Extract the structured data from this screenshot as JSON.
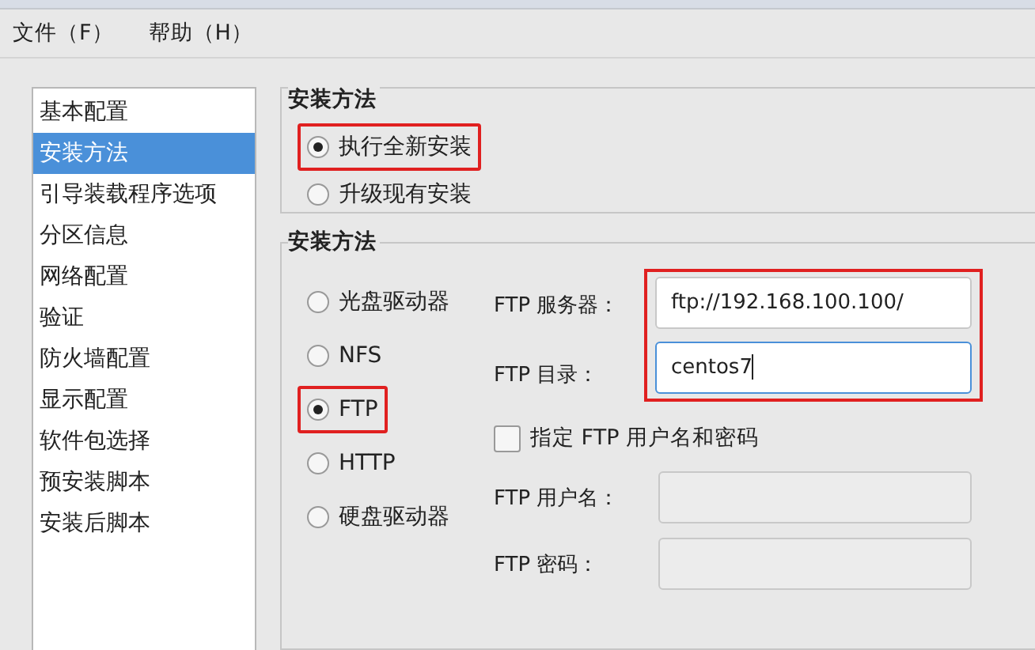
{
  "menu": [
    "文件（F）",
    "帮助（H）"
  ],
  "sidebar": {
    "items": [
      {
        "label": "基本配置",
        "selected": false
      },
      {
        "label": "安装方法",
        "selected": true
      },
      {
        "label": "引导装载程序选项",
        "selected": false
      },
      {
        "label": "分区信息",
        "selected": false
      },
      {
        "label": "网络配置",
        "selected": false
      },
      {
        "label": "验证",
        "selected": false
      },
      {
        "label": "防火墙配置",
        "selected": false
      },
      {
        "label": "显示配置",
        "selected": false
      },
      {
        "label": "软件包选择",
        "selected": false
      },
      {
        "label": "预安装脚本",
        "selected": false
      },
      {
        "label": "安装后脚本",
        "selected": false
      }
    ]
  },
  "install_type": {
    "title": "安装方法",
    "options": [
      {
        "label": "执行全新安装",
        "selected": true,
        "highlighted": true
      },
      {
        "label": "升级现有安装",
        "selected": false,
        "highlighted": false
      }
    ]
  },
  "install_source": {
    "title": "安装方法",
    "options": [
      {
        "label": "光盘驱动器",
        "selected": false,
        "highlighted": false
      },
      {
        "label": "NFS",
        "selected": false,
        "highlighted": false
      },
      {
        "label": "FTP",
        "selected": true,
        "highlighted": true
      },
      {
        "label": "HTTP",
        "selected": false,
        "highlighted": false
      },
      {
        "label": "硬盘驱动器",
        "selected": false,
        "highlighted": false
      }
    ],
    "location": {
      "highlighted": true,
      "fields": [
        {
          "label": "FTP 服务器：",
          "value": "ftp://192.168.100.100/",
          "focused": false
        },
        {
          "label": "FTP 目录：",
          "value": "centos7",
          "focused": true
        }
      ]
    },
    "credentials_checkbox": {
      "label": "指定  FTP 用户名和密码",
      "checked": false
    },
    "credentials": [
      {
        "label": "FTP 用户名：",
        "disabled": true
      },
      {
        "label": "FTP 密码：",
        "disabled": true
      }
    ]
  }
}
